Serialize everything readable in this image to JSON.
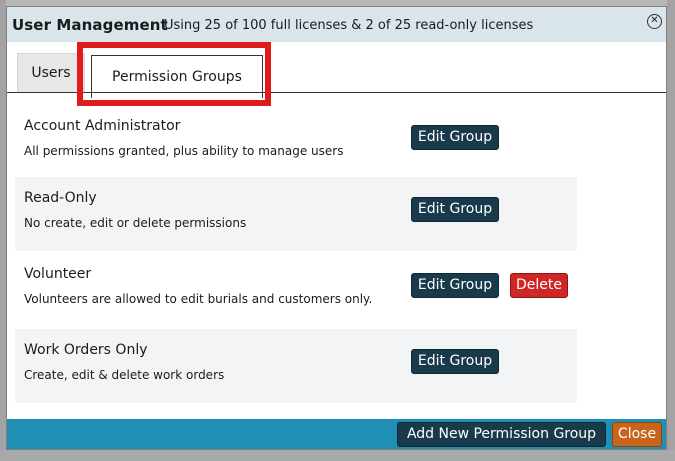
{
  "dialog": {
    "title": "User Management",
    "subtitle": "Using 25 of 100 full licenses & 2 of 25 read-only licenses",
    "close_glyph": "✕"
  },
  "tabs": [
    {
      "label": "Users",
      "active": false
    },
    {
      "label": "Permission Groups",
      "active": true
    }
  ],
  "groups": [
    {
      "name": "Account Administrator",
      "description": "All permissions granted, plus ability to manage users",
      "edit_label": "Edit Group"
    },
    {
      "name": "Read-Only",
      "description": "No create, edit or delete permissions",
      "edit_label": "Edit Group"
    },
    {
      "name": "Volunteer",
      "description": "Volunteers are allowed to edit burials and customers only.",
      "edit_label": "Edit Group",
      "delete_label": "Delete"
    },
    {
      "name": "Work Orders Only",
      "description": "Create, edit & delete work orders",
      "edit_label": "Edit Group"
    }
  ],
  "footer": {
    "add_label": "Add New Permission Group",
    "close_label": "Close"
  },
  "colors": {
    "titlebar": "#d9e5ea",
    "footer": "#1f8fb3",
    "primary_button": "#183a4b",
    "danger_button": "#cf2626",
    "close_button": "#c9651a",
    "highlight": "#e01b1b"
  }
}
